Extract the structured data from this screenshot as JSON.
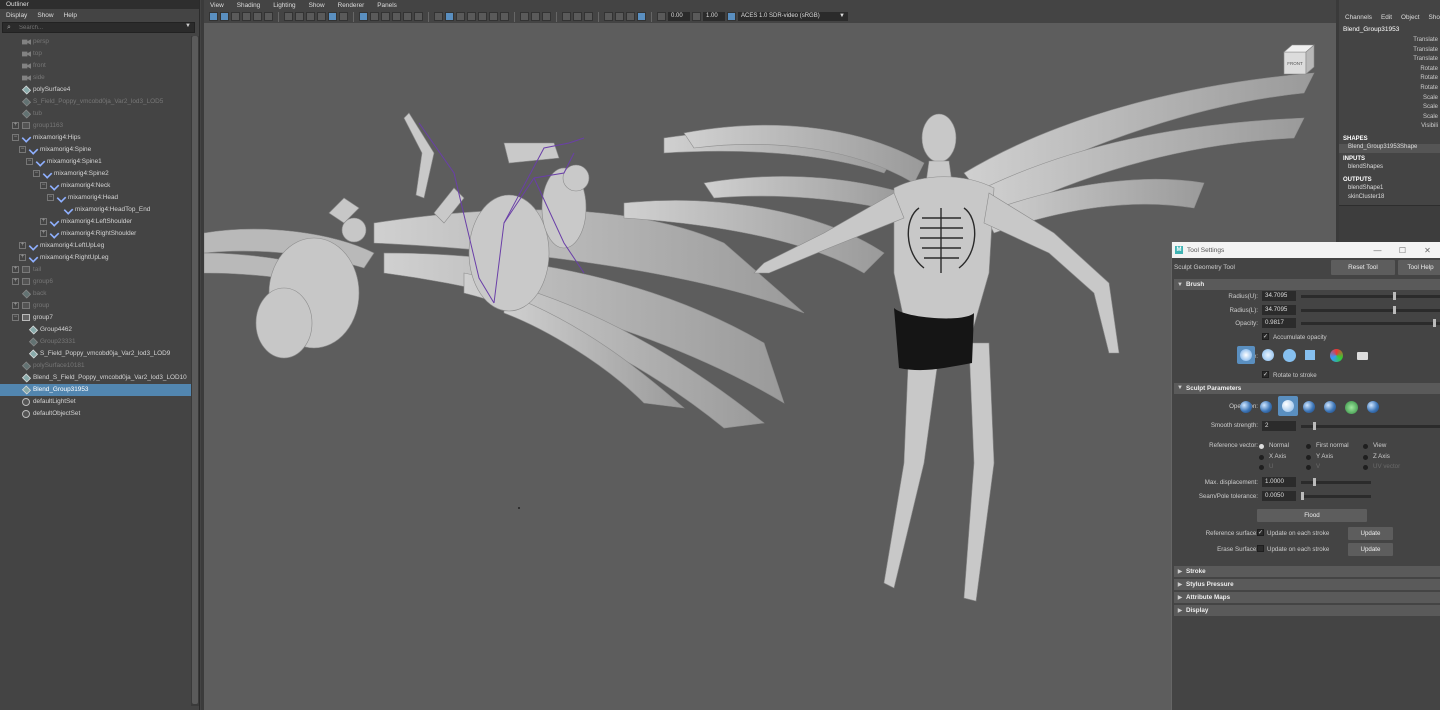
{
  "outliner": {
    "title": "Outliner",
    "menu": [
      "Display",
      "Show",
      "Help"
    ],
    "search_placeholder": "Search...",
    "items": [
      {
        "label": "persp",
        "icon": "camera-icon",
        "indent": 1,
        "dim": true
      },
      {
        "label": "top",
        "icon": "camera-icon",
        "indent": 1,
        "dim": true
      },
      {
        "label": "front",
        "icon": "camera-icon",
        "indent": 1,
        "dim": true
      },
      {
        "label": "side",
        "icon": "camera-icon",
        "indent": 1,
        "dim": true
      },
      {
        "label": "polySurface4",
        "icon": "mesh-icon",
        "indent": 1,
        "dim": false
      },
      {
        "label": "S_Field_Poppy_vmcobd0ja_Var2_lod3_LOD5",
        "icon": "mesh-icon",
        "indent": 1,
        "dim": true
      },
      {
        "label": "tub",
        "icon": "mesh-icon",
        "indent": 1,
        "dim": true
      },
      {
        "label": "group1163",
        "icon": "group-icon",
        "indent": 1,
        "dim": true,
        "exp": "+"
      },
      {
        "label": "mixamorig4:Hips",
        "icon": "joint-icon",
        "indent": 1,
        "dim": false,
        "exp": "−"
      },
      {
        "label": "mixamorig4:Spine",
        "icon": "joint-icon",
        "indent": 2,
        "dim": false,
        "exp": "−"
      },
      {
        "label": "mixamorig4:Spine1",
        "icon": "joint-icon",
        "indent": 3,
        "dim": false,
        "exp": "−"
      },
      {
        "label": "mixamorig4:Spine2",
        "icon": "joint-icon",
        "indent": 4,
        "dim": false,
        "exp": "−"
      },
      {
        "label": "mixamorig4:Neck",
        "icon": "joint-icon",
        "indent": 5,
        "dim": false,
        "exp": "−"
      },
      {
        "label": "mixamorig4:Head",
        "icon": "joint-icon",
        "indent": 6,
        "dim": false,
        "exp": "−"
      },
      {
        "label": "mixamorig4:HeadTop_End",
        "icon": "joint-icon",
        "indent": 7,
        "dim": false
      },
      {
        "label": "mixamorig4:LeftShoulder",
        "icon": "joint-icon",
        "indent": 5,
        "dim": false,
        "exp": "+"
      },
      {
        "label": "mixamorig4:RightShoulder",
        "icon": "joint-icon",
        "indent": 5,
        "dim": false,
        "exp": "+"
      },
      {
        "label": "mixamorig4:LeftUpLeg",
        "icon": "joint-icon",
        "indent": 2,
        "dim": false,
        "exp": "+"
      },
      {
        "label": "mixamorig4:RightUpLeg",
        "icon": "joint-icon",
        "indent": 2,
        "dim": false,
        "exp": "+"
      },
      {
        "label": "tail",
        "icon": "group-icon",
        "indent": 1,
        "dim": true,
        "exp": "+"
      },
      {
        "label": "group6",
        "icon": "group-icon",
        "indent": 1,
        "dim": true,
        "exp": "+"
      },
      {
        "label": "back",
        "icon": "mesh-icon",
        "indent": 1,
        "dim": true
      },
      {
        "label": "group",
        "icon": "group-icon",
        "indent": 1,
        "dim": true,
        "exp": "+"
      },
      {
        "label": "group7",
        "icon": "group-icon",
        "indent": 1,
        "dim": false,
        "exp": "−"
      },
      {
        "label": "Group4462",
        "icon": "mesh-icon",
        "indent": 2,
        "dim": false
      },
      {
        "label": "Group23331",
        "icon": "mesh-icon",
        "indent": 2,
        "dim": true
      },
      {
        "label": "S_Field_Poppy_vmcobd0ja_Var2_lod3_LOD9",
        "icon": "mesh-icon",
        "indent": 2,
        "dim": false
      },
      {
        "label": "polySurface10181",
        "icon": "mesh-icon",
        "indent": 1,
        "dim": true
      },
      {
        "label": "Blend_S_Field_Poppy_vmcobd0ja_Var2_lod3_LOD10",
        "icon": "mesh-icon",
        "indent": 1,
        "dim": false
      },
      {
        "label": "Blend_Group31953",
        "icon": "mesh-icon",
        "indent": 1,
        "dim": false,
        "selected": true
      },
      {
        "label": "defaultLightSet",
        "icon": "set-icon",
        "indent": 1,
        "dim": false
      },
      {
        "label": "defaultObjectSet",
        "icon": "set-icon",
        "indent": 1,
        "dim": false
      }
    ]
  },
  "viewport": {
    "menu": [
      "View",
      "Shading",
      "Lighting",
      "Show",
      "Renderer",
      "Panels"
    ],
    "field1": "0.00",
    "field2": "1.00",
    "colorspace": "ACES 1.0 SDR-video (sRGB)",
    "viewcube_label": "FRONT"
  },
  "channel_box": {
    "menu": [
      "Channels",
      "Edit",
      "Object",
      "Sho"
    ],
    "object": "Blend_Group31953",
    "attributes": [
      "Translate",
      "Translate",
      "Translate",
      "Rotate",
      "Rotate",
      "Rotate",
      "Scale",
      "Scale",
      "Scale",
      "Visibili"
    ],
    "shapes_title": "SHAPES",
    "shape": "Blend_Group31953Shape",
    "inputs_title": "INPUTS",
    "inputs": [
      "blendShapes"
    ],
    "outputs_title": "OUTPUTS",
    "outputs": [
      "blendShape1",
      "skinCluster18"
    ]
  },
  "tool_settings": {
    "window_title": "Tool Settings",
    "tool_name": "Sculpt Geometry Tool",
    "reset_label": "Reset Tool",
    "help_label": "Tool Help",
    "brush": {
      "title": "Brush",
      "radius_u_label": "Radius(U):",
      "radius_u": "34.7095",
      "radius_l_label": "Radius(L):",
      "radius_l": "34.7095",
      "opacity_label": "Opacity:",
      "opacity": "0.9817",
      "accumulate_label": "Accumulate opacity",
      "profile_label": "Profile:",
      "rotate_label": "Rotate to stroke"
    },
    "sculpt": {
      "title": "Sculpt Parameters",
      "operation_label": "Operation:",
      "smooth_label": "Smooth strength:",
      "smooth": "2",
      "refvec_label": "Reference vector:",
      "refvec_options": [
        "Normal",
        "First normal",
        "View",
        "X Axis",
        "Y Axis",
        "Z Axis",
        "U",
        "V",
        "UV vector"
      ],
      "maxdisp_label": "Max. displacement:",
      "maxdisp": "1.0000",
      "seam_label": "Seam/Pole tolerance:",
      "seam": "0.0050",
      "flood_label": "Flood",
      "refsurf_label": "Reference surface:",
      "erase_label": "Erase Surface:",
      "update_each": "Update on each stroke",
      "update_label": "Update"
    },
    "collapsed_sections": [
      "Stroke",
      "Stylus Pressure",
      "Attribute Maps",
      "Display"
    ]
  }
}
